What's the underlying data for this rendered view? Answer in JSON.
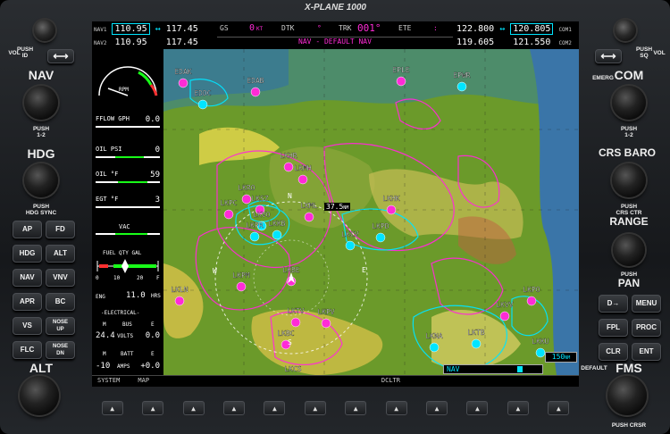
{
  "brand": "X-PLANE 1000",
  "nav": {
    "nav1_label": "NAV1",
    "nav1_active": "110.95",
    "nav1_standby": "117.45",
    "nav2_label": "NAV2",
    "nav2_active": "110.95",
    "nav2_standby": "117.45",
    "swap_glyph": "↔"
  },
  "com": {
    "com1_label": "COM1",
    "com1_standby": "122.800",
    "com1_active": "120.805",
    "com2_label": "COM2",
    "com2_standby": "119.605",
    "com2_active": "121.550"
  },
  "status": {
    "gs_label": "GS",
    "gs_value": "0",
    "gs_unit": "KT",
    "dtk_label": "DTK",
    "dtk_value": "°",
    "trk_label": "TRK",
    "trk_value": "001°",
    "ete_label": "ETE",
    "ete_value": ":",
    "nav_mode": "NAV - DEFAULT NAV"
  },
  "eis": {
    "rpm_label": "RPM",
    "fflow_label": "FFLOW GPH",
    "fflow_value": "0.0",
    "oilpsi_label": "OIL PSI",
    "oilpsi_value": "0",
    "oilf_label": "OIL °F",
    "oilf_value": "59",
    "egt_label": "EGT °F",
    "egt_value": "3",
    "vac_label": "VAC",
    "fuel_label": "FUEL QTY GAL",
    "fuel_scale": [
      "0",
      "10",
      "20",
      "F"
    ],
    "eng_label": "ENG",
    "eng_value": "11.0",
    "eng_unit": "HRS",
    "electrical_label": "-ELECTRICAL-",
    "bus_header_m": "M",
    "bus_header": "BUS",
    "bus_header_e": "E",
    "volts_value": "24.4",
    "volts_unit": "VOLTS",
    "volts_e": "0.0",
    "batt_header_m": "M",
    "batt_header": "BATT",
    "batt_header_e": "E",
    "amps_value": "-10",
    "amps_unit": "AMPS",
    "amps_e": "+0.0"
  },
  "map": {
    "range_readout": "37.5",
    "range_unit": "NM",
    "map_range": "150",
    "map_range_unit": "NM",
    "nav_label": "NAV",
    "airports": [
      {
        "id": "EDAK",
        "color": "mag"
      },
      {
        "id": "EDAB",
        "color": "mag"
      },
      {
        "id": "EDDC",
        "color": "cyan"
      },
      {
        "id": "EPLE",
        "color": "mag"
      },
      {
        "id": "EPWR",
        "color": "cyan"
      },
      {
        "id": "LKHR",
        "color": "mag"
      },
      {
        "id": "LKMH",
        "color": "mag"
      },
      {
        "id": "LKRO",
        "color": "mag"
      },
      {
        "id": "LKSZ",
        "color": "mag"
      },
      {
        "id": "LKPC",
        "color": "mag"
      },
      {
        "id": "LKVO",
        "color": "cyan"
      },
      {
        "id": "LKPR",
        "color": "cyan"
      },
      {
        "id": "LKKB",
        "color": "cyan"
      },
      {
        "id": "LKML",
        "color": "mag"
      },
      {
        "id": "LKHK",
        "color": "mag"
      },
      {
        "id": "LKPD",
        "color": "cyan"
      },
      {
        "id": "LKCV",
        "color": "cyan"
      },
      {
        "id": "LKPM",
        "color": "mag"
      },
      {
        "id": "LKBE",
        "color": "mag"
      },
      {
        "id": "LKLN",
        "color": "mag"
      },
      {
        "id": "LKTV",
        "color": "mag"
      },
      {
        "id": "LKPV",
        "color": "mag"
      },
      {
        "id": "LKBC",
        "color": "mag"
      },
      {
        "id": "LKNA",
        "color": "cyan"
      },
      {
        "id": "LKTB",
        "color": "cyan"
      },
      {
        "id": "LKVV",
        "color": "mag"
      },
      {
        "id": "LKPO",
        "color": "mag"
      },
      {
        "id": "LKKU",
        "color": "cyan"
      },
      {
        "id": "LKCS",
        "color": "mag"
      }
    ],
    "compass": {
      "n": "N",
      "e": "E",
      "s": "S",
      "w": "W"
    }
  },
  "softkeys": [
    "SYSTEM",
    "MAP",
    "",
    "",
    "",
    "",
    "",
    "DCLTR",
    "",
    "",
    "",
    ""
  ],
  "left_panel": {
    "vol_label": "VOL",
    "push_id": "PUSH\nID",
    "nav_label": "NAV",
    "nav_push": "PUSH\n1-2",
    "hdg_label": "HDG",
    "hdg_push": "PUSH\nHDG SYNC",
    "alt_label": "ALT",
    "keys": [
      "AP",
      "FD",
      "HDG",
      "ALT",
      "NAV",
      "VNV",
      "APR",
      "BC",
      "VS",
      "NOSE\nUP",
      "FLC",
      "NOSE\nDN"
    ]
  },
  "right_panel": {
    "vol_label": "VOL",
    "push_sq": "PUSH\nSQ",
    "emerg_label": "EMERG",
    "com_label": "COM",
    "com_push": "PUSH\n1-2",
    "crs_label": "CRS BARO",
    "crs_push": "PUSH\nCRS CTR",
    "range_label": "RANGE",
    "pan_label": "PAN",
    "push_label": "PUSH",
    "keys": [
      "D→",
      "MENU",
      "FPL",
      "PROC",
      "CLR",
      "ENT"
    ],
    "default_label": "DEFAULT",
    "fms_label": "FMS",
    "fms_push": "PUSH CRSR"
  },
  "colors": {
    "cyan": "#00e5ff",
    "magenta": "#ff2bd6",
    "green": "#19ff19",
    "terrain_green": "#6b9a2a",
    "terrain_yellow": "#d6c24a",
    "water_blue": "#2f6fb0"
  }
}
